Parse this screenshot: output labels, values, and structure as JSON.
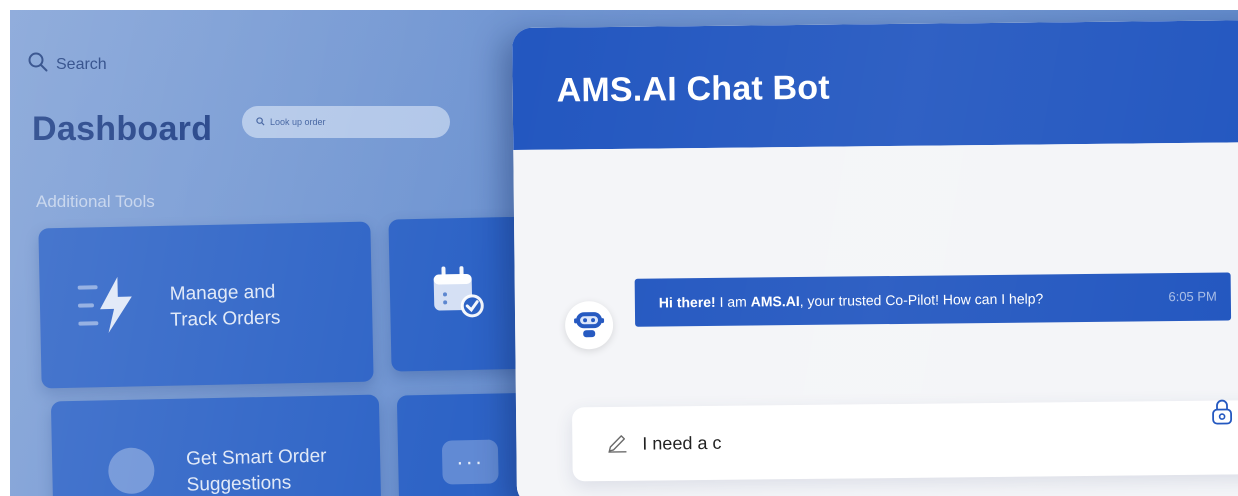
{
  "dashboard": {
    "search_label": "Search",
    "title": "Dashboard",
    "lookup_placeholder": "Look up order",
    "section_title": "Additional Tools",
    "cards": [
      {
        "label_line1": "Manage and",
        "label_line2": "Track Orders",
        "icon": "lightning-icon"
      },
      {
        "label_line1": "",
        "label_line2": "",
        "icon": "calendar-check-icon"
      },
      {
        "label_line1": "Get Smart Order",
        "label_line2": "Suggestions",
        "icon": "circle-icon"
      },
      {
        "label_line1": "",
        "label_line2": "",
        "icon": "more-dots-icon"
      }
    ]
  },
  "chat": {
    "title": "AMS.AI Chat Bot",
    "message": {
      "greeting": "Hi there!",
      "mid": " I am ",
      "brand": "AMS.AI",
      "rest": ", your trusted Co-Pilot! How can I help?",
      "time": "6:05 PM"
    },
    "input_value": "I need a c"
  },
  "colors": {
    "accent": "#2357c0",
    "background": "#6d93d1",
    "card": "#2d63c6"
  }
}
